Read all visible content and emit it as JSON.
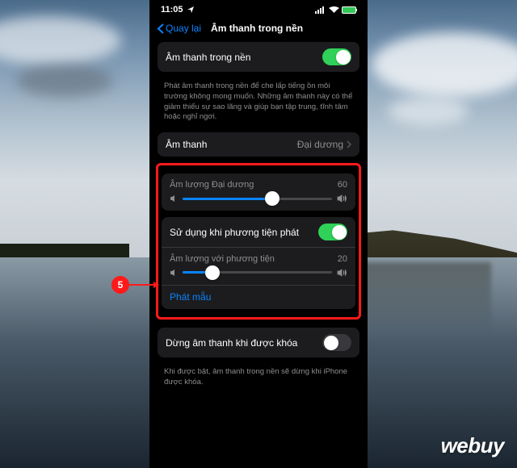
{
  "status": {
    "time": "11:05",
    "location_icon": "◀",
    "signal": "▬",
    "wifi": "✓"
  },
  "nav": {
    "back": "Quay lại",
    "title": "Âm thanh trong nền"
  },
  "section1": {
    "toggle_label": "Âm thanh trong nền",
    "toggle_on": true,
    "footer": "Phát âm thanh trong nền để che lấp tiếng ồn môi trường không mong muốn. Những âm thanh này có thể giảm thiểu sự sao lãng và giúp bạn tập trung, tĩnh tâm hoặc nghỉ ngơi."
  },
  "sound_row": {
    "label": "Âm thanh",
    "value": "Đại dương"
  },
  "volume1": {
    "label": "Âm lượng Đại dương",
    "value": 60,
    "percent": 60
  },
  "media": {
    "toggle_label": "Sử dụng khi phương tiện phát",
    "toggle_on": true,
    "vol_label": "Âm lượng với phương tiện",
    "vol_value": 20,
    "vol_percent": 20,
    "sample": "Phát mẫu"
  },
  "lock": {
    "label": "Dừng âm thanh khi được khóa",
    "on": false,
    "footer": "Khi được bật, âm thanh trong nền sẽ dừng khi iPhone được khóa."
  },
  "callout": {
    "num": "5"
  },
  "watermark": "webuy"
}
